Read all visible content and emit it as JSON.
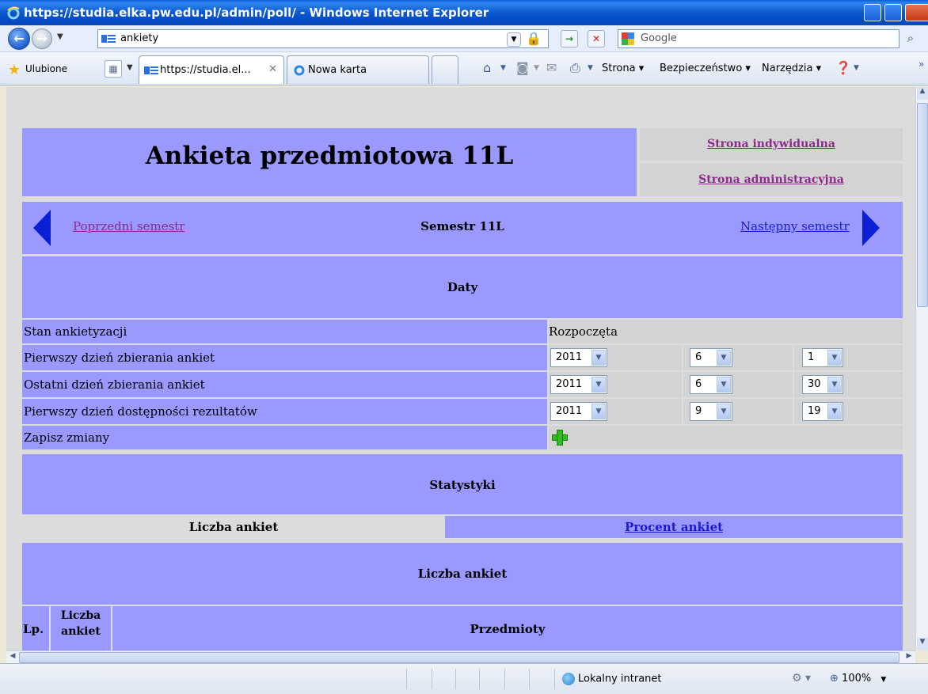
{
  "window": {
    "title": "https://studia.elka.pw.edu.pl/admin/poll/ - Windows Internet Explorer"
  },
  "address_bar": {
    "value": "ankiety"
  },
  "search": {
    "placeholder": "Google"
  },
  "favorites": {
    "label": "Ulubione"
  },
  "tabs": [
    {
      "label": "https://studia.el...",
      "active": true
    },
    {
      "label": "Nowa karta",
      "active": false
    }
  ],
  "command_bar": {
    "page": "Strona ▾",
    "safety": "Bezpieczeństwo ▾",
    "tools": "Narzędzia ▾"
  },
  "header": {
    "title": "Ankieta przedmiotowa 11L",
    "link_individual": "Strona indywidualna",
    "link_admin": "Strona administracyjna"
  },
  "semester_nav": {
    "prev": "Poprzedni semestr",
    "current": "Semestr 11L",
    "next": "Następny semestr"
  },
  "dates": {
    "section_title": "Daty",
    "rows": [
      {
        "label": "Stan ankietyzacji",
        "value": "Rozpoczęta"
      },
      {
        "label": "Pierwszy dzień zbierania ankiet",
        "year": "2011",
        "month": "6",
        "day": "1"
      },
      {
        "label": "Ostatni dzień zbierania ankiet",
        "year": "2011",
        "month": "6",
        "day": "30"
      },
      {
        "label": "Pierwszy dzień dostępności rezultatów",
        "year": "2011",
        "month": "9",
        "day": "19"
      },
      {
        "label": "Zapisz zmiany"
      }
    ]
  },
  "stats": {
    "section_title": "Statystyki",
    "tab_count": "Liczba ankiet",
    "tab_percent": "Procent ankiet",
    "sub_title": "Liczba ankiet",
    "col_lp": "Lp.",
    "col_count_1": "Liczba",
    "col_count_2": "ankiet",
    "col_subjects": "Przedmioty"
  },
  "status_bar": {
    "zone": "Lokalny intranet",
    "zoom": "100%"
  },
  "colors": {
    "section_bg": "#9999ff",
    "row_gray": "#d3d3d3",
    "link": "#1a1ad6",
    "visited": "#8a2a8a"
  }
}
